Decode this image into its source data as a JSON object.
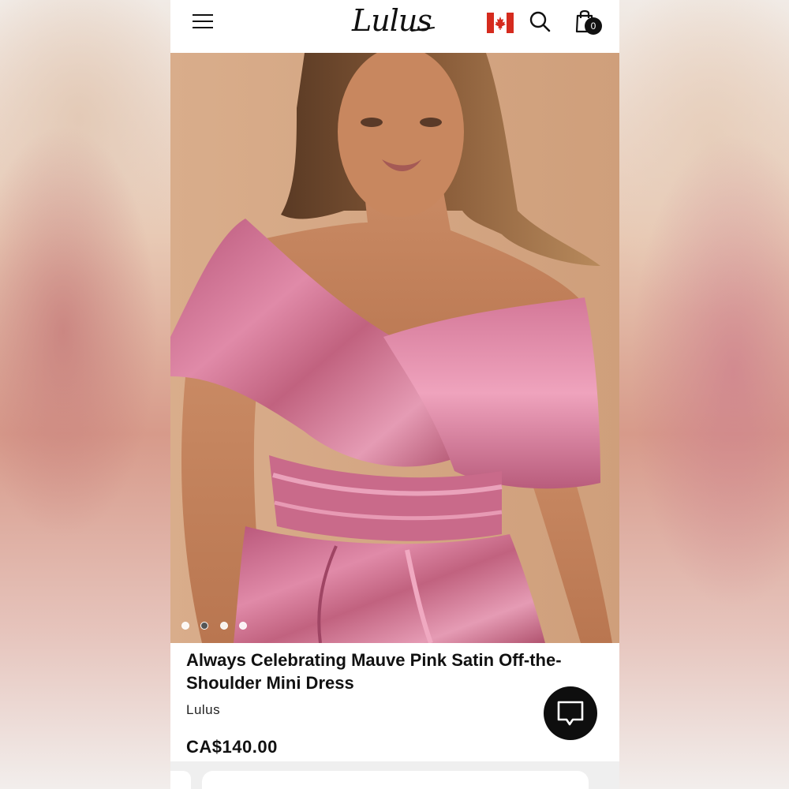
{
  "header": {
    "logo_text": "Lulus",
    "cart_count": "0",
    "icons": [
      "menu-icon",
      "canada-flag-icon",
      "search-icon",
      "shopping-bag-icon"
    ]
  },
  "gallery": {
    "image_count": 4,
    "active_index": 1
  },
  "product": {
    "title": "Always Celebrating Mauve Pink Satin Off-the-Shoulder Mini Dress",
    "brand": "Lulus",
    "price": "CA$140.00"
  },
  "colors": {
    "dress": "#c86a8a",
    "background_hero": "#d6a987",
    "chat_button": "#0e0e0e",
    "flag_red": "#d52b1e"
  }
}
